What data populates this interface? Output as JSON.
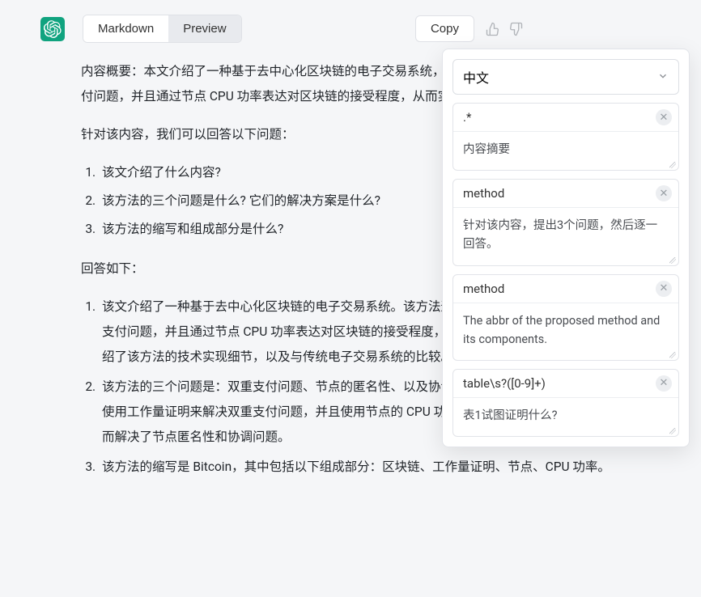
{
  "toolbar": {
    "tabs": {
      "markdown": "Markdown",
      "preview": "Preview",
      "active": "preview"
    },
    "copy": "Copy"
  },
  "content": {
    "summary": "内容概要：本文介绍了一种基于去中心化区块链的电子交易系统，它使用工作量证明来防止双重支付问题，并且通过节点 CPU 功率表达对区块链的接受程度，从而实现了去信任化。",
    "questions_intro": "针对该内容，我们可以回答以下问题：",
    "questions": [
      "该文介绍了什么内容?",
      "该方法的三个问题是什么? 它们的解决方案是什么?",
      "该方法的缩写和组成部分是什么?"
    ],
    "answers_intro": "回答如下：",
    "answers": [
      "该文介绍了一种基于去中心化区块链的电子交易系统。该方法通过使用工作量证明来防止双重支付问题，并且通过节点 CPU 功率表达对区块链的接受程度，从而实现了去信任化。该文还介绍了该方法的技术实现细节，以及与传统电子交易系统的比较。",
      "该方法的三个问题是：双重支付问题、节点的匿名性、以及协调节点之间的工作。该方法通过使用工作量证明来解决双重支付问题，并且使用节点的 CPU 功率表达对区块链的接受程度，从而解决了节点匿名性和协调问题。",
      "该方法的缩写是 Bitcoin，其中包括以下组成部分：区块链、工作量证明、节点、CPU 功率。"
    ]
  },
  "panel": {
    "language": "中文",
    "groups": [
      {
        "head": ".*",
        "body": "内容摘要"
      },
      {
        "head": "method",
        "body": "针对该内容，提出3个问题，然后逐一回答。"
      },
      {
        "head": "method",
        "body": "The abbr of the proposed method and its components."
      },
      {
        "head": "table\\s?([0-9]+)",
        "body": "表1试图证明什么?"
      }
    ]
  }
}
